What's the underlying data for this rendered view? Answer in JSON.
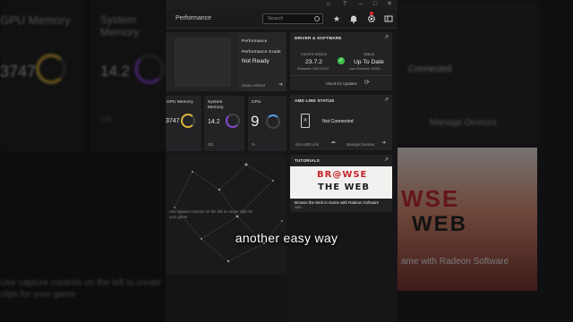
{
  "window_buttons": [
    "⌂",
    "?",
    "–",
    "□",
    "✕"
  ],
  "nav": {
    "title": "Performance",
    "search_placeholder": "Search",
    "icons": [
      "star-icon",
      "bell-icon",
      "gear-icon",
      "layout-icon"
    ]
  },
  "perf_card": {
    "title": "Performance",
    "grade_label": "Performance Grade",
    "grade_value": "Not Ready",
    "advisor_link": "Game Advisor"
  },
  "driver_card": {
    "title": "DRIVER & SOFTWARE",
    "current_label": "Current Version",
    "current_value": "23.7.2",
    "release": "Released: 20/07/2023",
    "status_label": "Status",
    "status_value": "Up To Date",
    "last_checked": "Last Checked: 15/08/...",
    "check_updates": "Check for Updates"
  },
  "metrics": [
    {
      "label": "GPU Memory",
      "value": "3747",
      "unit": "",
      "ring_color": "#e0b63a"
    },
    {
      "label": "System Memory",
      "value": "14.2",
      "unit": "GB",
      "ring_color": "#8a49d6"
    },
    {
      "label": "CPU",
      "value": "9",
      "unit": "%",
      "ring_color": "#5aa2e6"
    }
  ],
  "amd_link": {
    "title": "AMD LINK STATUS",
    "status": "Not Connected",
    "get_link": "Get AMD Link",
    "manage": "Manage Devices"
  },
  "tutorials": {
    "title": "TUTORIALS",
    "banner_line1": "BR@WSE",
    "banner_line2": "THE WEB",
    "caption": "Browse the Web in Game with Radeon Software",
    "sub": "AMD"
  },
  "capture_hint": "Use capture controls on the left to create clips for your game",
  "subtitle": "another easy way",
  "background": {
    "gpu_mem_label": "GPU Memory",
    "gpu_mem_value": "3747",
    "sys_mem_label": "System Memory",
    "sys_mem_value": "14.2",
    "sys_mem_unit": "GB",
    "connected": "Connected",
    "manage": "Manage Devices",
    "banner1": "WSE",
    "banner2": "WEB",
    "game_caption": "ame with Radeon Software",
    "capture_hint": "Use capture controls on the left to create clips for your game"
  },
  "colors": {
    "accent_red": "#e2262b",
    "ok_green": "#3cc24a"
  }
}
